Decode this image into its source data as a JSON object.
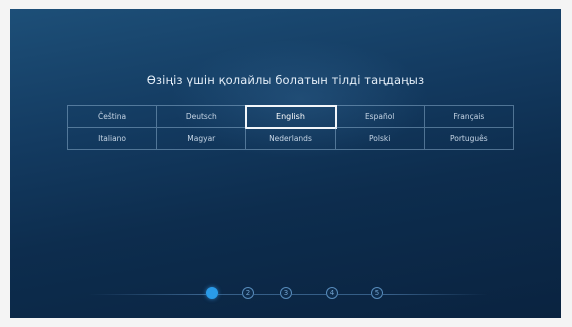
{
  "title": "Өзіңіз үшін қолайлы болатын тілді таңдаңыз",
  "languages": [
    "Čeština",
    "Deutsch",
    "English",
    "Español",
    "Français",
    "Italiano",
    "Magyar",
    "Nederlands",
    "Polski",
    "Português"
  ],
  "selected_language": "English",
  "steps": [
    "1",
    "2",
    "3",
    "4",
    "5"
  ],
  "current_step": 1,
  "colors": {
    "background": "#133a60",
    "accent": "#2a9be8",
    "text": "#e4eef8"
  }
}
